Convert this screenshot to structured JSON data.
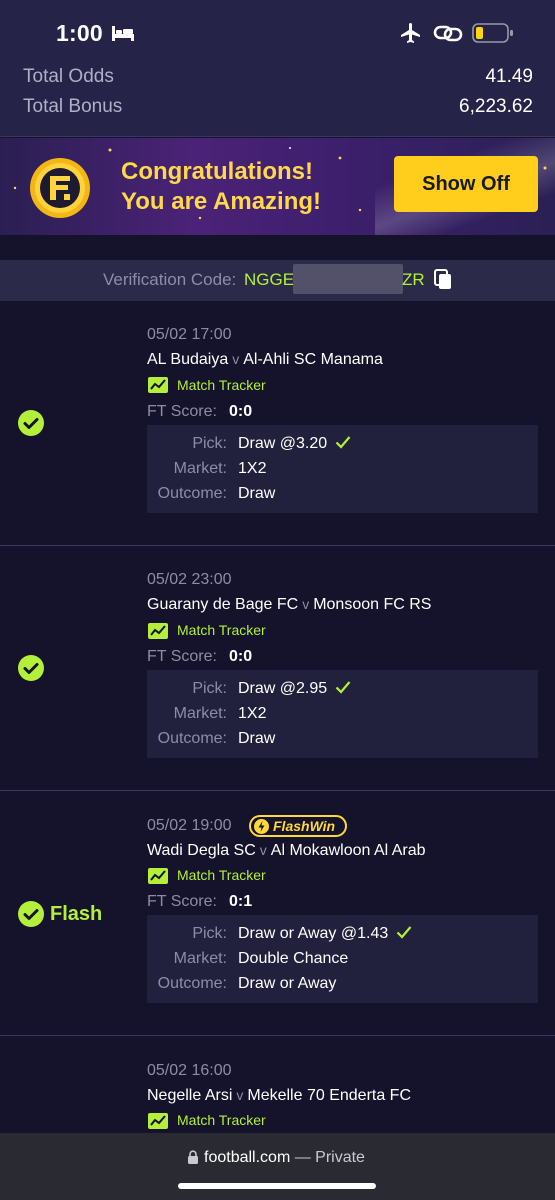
{
  "status_bar": {
    "time": "1:00"
  },
  "totals": {
    "odds_label": "Total Odds",
    "odds_value": "41.49",
    "bonus_label": "Total Bonus",
    "bonus_value": "6,223.62"
  },
  "banner": {
    "line1": "Congratulations!",
    "line2": "You are Amazing!",
    "button_label": "Show Off",
    "accent": "#ffcd1c"
  },
  "verification": {
    "label": "Verification Code:",
    "code_start": "NGGE1",
    "code_end": "ZR"
  },
  "labels": {
    "match_tracker": "Match Tracker",
    "ft_score": "FT Score:",
    "pick": "Pick:",
    "market": "Market:",
    "outcome": "Outcome:",
    "versus": "v",
    "flashwin": "FlashWin",
    "flash": "Flash"
  },
  "bets": [
    {
      "date": "05/02 17:00",
      "home": "AL Budaiya",
      "away": "Al-Ahli SC Manama",
      "ft_score": "0:0",
      "pick": "Draw @3.20",
      "market": "1X2",
      "outcome": "Draw"
    },
    {
      "date": "05/02 23:00",
      "home": "Guarany de Bage FC",
      "away": "Monsoon FC RS",
      "ft_score": "0:0",
      "pick": "Draw @2.95",
      "market": "1X2",
      "outcome": "Draw"
    },
    {
      "date": "05/02 19:00",
      "home": "Wadi Degla SC",
      "away": "Al Mokawloon Al Arab",
      "ft_score": "0:1",
      "pick": "Draw or Away @1.43",
      "market": "Double Chance",
      "outcome": "Draw or Away"
    },
    {
      "date": "05/02 16:00",
      "home": "Negelle Arsi",
      "away": "Mekelle 70 Enderta FC"
    }
  ],
  "browser": {
    "domain": "football.com",
    "suffix": " — Private"
  },
  "colors": {
    "win_green": "#b4f03a",
    "background": "#15132b",
    "header": "#262348"
  }
}
